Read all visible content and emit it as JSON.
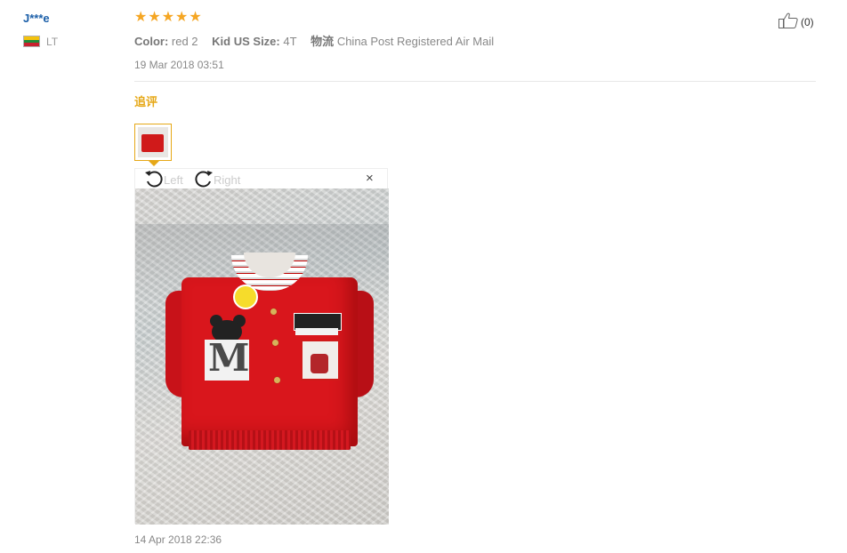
{
  "reviewer": {
    "name": "J***e",
    "country": "LT",
    "flag_colors": [
      "#f4c20d",
      "#1e8a3a",
      "#c8202e"
    ]
  },
  "review": {
    "rating": 5,
    "max_rating": 5,
    "star_glyph": "★",
    "star_color": "#f5a623",
    "attributes": [
      {
        "key": "Color:",
        "value": "red 2"
      },
      {
        "key": "Kid US Size:",
        "value": "4T"
      },
      {
        "key": "物流",
        "value": "China Post Registered Air Mail"
      }
    ],
    "date": "19 Mar 2018 03:51",
    "helpful": {
      "icon": "thumbs-up-icon",
      "count_label": "(0)"
    }
  },
  "followup": {
    "label": "追评",
    "accent_color": "#e6a817",
    "image_viewer": {
      "rotate_left_label": "Left",
      "rotate_right_label": "Right",
      "close_glyph": "×"
    },
    "date": "14 Apr 2018 22:36"
  }
}
